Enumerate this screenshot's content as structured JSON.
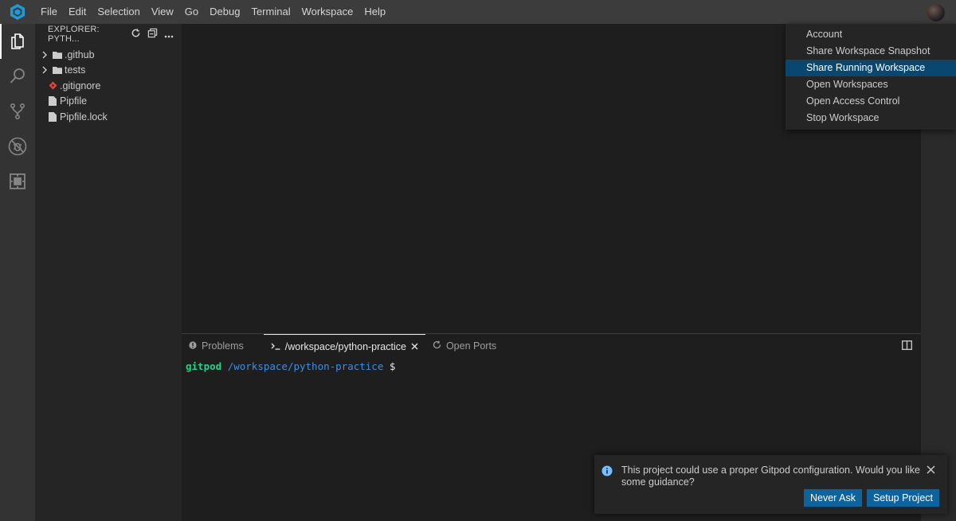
{
  "menubar": {
    "items": [
      "File",
      "Edit",
      "Selection",
      "View",
      "Go",
      "Debug",
      "Terminal",
      "Workspace",
      "Help"
    ]
  },
  "activitybar": {
    "icons": [
      "explorer-icon",
      "search-icon",
      "source-control-icon",
      "debug-icon",
      "extensions-icon"
    ]
  },
  "explorer": {
    "title": "EXPLORER: PYTH...",
    "tree": [
      {
        "label": ".github",
        "type": "folder"
      },
      {
        "label": "tests",
        "type": "folder"
      },
      {
        "label": ".gitignore",
        "type": "git-file"
      },
      {
        "label": "Pipfile",
        "type": "file"
      },
      {
        "label": "Pipfile.lock",
        "type": "file"
      }
    ]
  },
  "panel": {
    "tabs": [
      {
        "label": "Problems"
      },
      {
        "label": "/workspace/python-practice",
        "active": true
      },
      {
        "label": "Open Ports"
      }
    ],
    "terminal": {
      "user": "gitpod",
      "path": "/workspace/python-practice",
      "prompt": "$"
    }
  },
  "context_menu": {
    "items": [
      {
        "label": "Account"
      },
      {
        "label": "Share Workspace Snapshot"
      },
      {
        "label": "Share Running Workspace",
        "selected": true
      },
      {
        "label": "Open Workspaces"
      },
      {
        "label": "Open Access Control"
      },
      {
        "label": "Stop Workspace"
      }
    ]
  },
  "notification": {
    "message": "This project could use a proper Gitpod configuration. Would you like some guidance?",
    "never_ask_label": "Never Ask",
    "setup_label": "Setup Project"
  },
  "colors": {
    "accent": "#0e639c",
    "selection": "#094771",
    "terminal_user": "#23d18b",
    "terminal_path": "#3b8eea",
    "logo": "#1e9ad6"
  }
}
